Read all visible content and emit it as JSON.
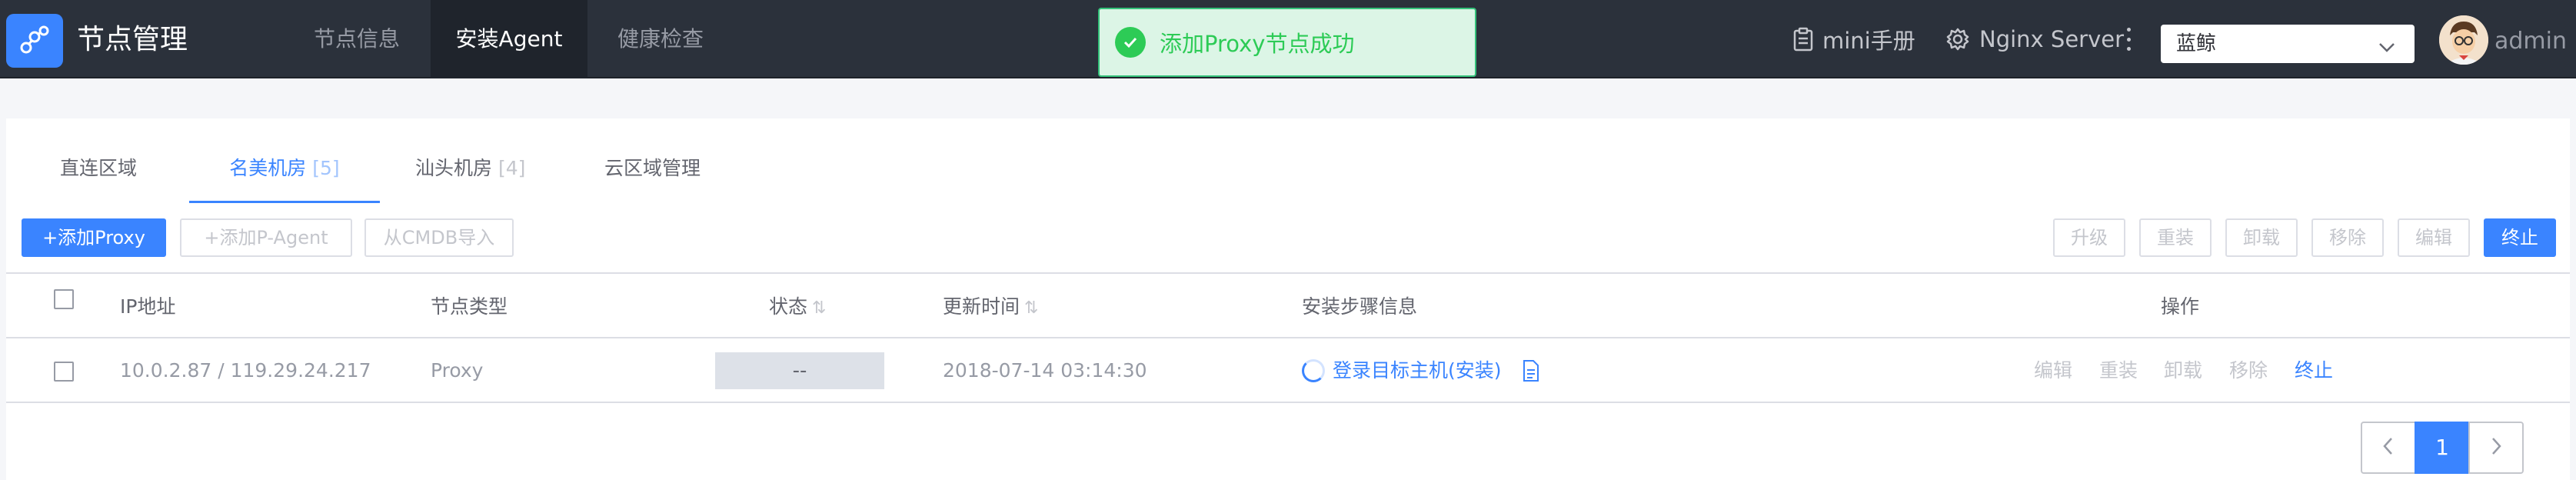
{
  "app": {
    "title": "节点管理"
  },
  "nav": {
    "items": [
      {
        "label": "节点信息"
      },
      {
        "label": "安装Agent",
        "active": true
      },
      {
        "label": "健康检查"
      }
    ]
  },
  "toast": {
    "message": "添加Proxy节点成功",
    "color": "#2dcb56"
  },
  "header_tools": {
    "manual_label": "mini手册",
    "server_label": "Nginx Server",
    "business_select": "蓝鲸",
    "username": "admin"
  },
  "tabs": [
    {
      "label": "直连区域",
      "count": ""
    },
    {
      "label": "名美机房",
      "count": "[5]",
      "active": true
    },
    {
      "label": "汕头机房",
      "count": "[4]"
    },
    {
      "label": "云区域管理",
      "count": ""
    }
  ],
  "toolbar": {
    "add_proxy": "+添加Proxy",
    "add_pagent": "+添加P-Agent",
    "import_cmdb": "从CMDB导入",
    "upgrade": "升级",
    "reinstall": "重装",
    "uninstall": "卸载",
    "remove": "移除",
    "edit": "编辑",
    "stop": "终止"
  },
  "table": {
    "columns": {
      "ip": "IP地址",
      "type": "节点类型",
      "status": "状态",
      "time": "更新时间",
      "steps": "安装步骤信息",
      "actions": "操作"
    },
    "sort_icon": "⇅",
    "rows": [
      {
        "ip": "10.0.2.87 / 119.29.24.217",
        "type": "Proxy",
        "status": "--",
        "time": "2018-07-14 03:14:30",
        "step": "登录目标主机(安装)",
        "actions": {
          "edit": "编辑",
          "reinstall": "重装",
          "uninstall": "卸载",
          "remove": "移除",
          "stop": "终止"
        }
      }
    ]
  },
  "pagination": {
    "current": "1"
  },
  "colors": {
    "accent": "#3a84ff",
    "topbar": "#2b313b",
    "success": "#2dcb56"
  }
}
